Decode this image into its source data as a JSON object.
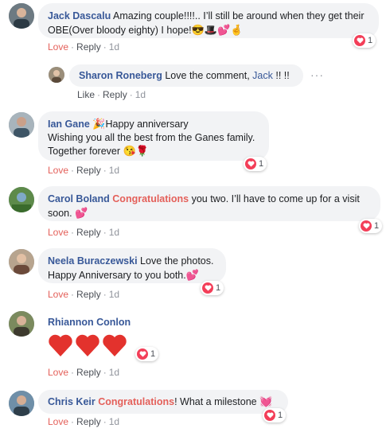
{
  "comments": [
    {
      "name": "Jack Dascalu",
      "text": "Amazing couple!!!!.. I’ll still be around when they get their OBE(Over bloody eighty) I hope!",
      "emoji": "😎🎩💕🤞",
      "reactions": "1",
      "love": "Love",
      "reply": "Reply",
      "time": "1d"
    },
    {
      "name": "Sharon Roneberg",
      "text_before": "Love the comment,",
      "mention": "Jack",
      "text_after": "!! !!",
      "more": "···",
      "like": "Like",
      "reply": "Reply",
      "time": "1d"
    },
    {
      "name": "Ian Gane",
      "emoji_start": "🎉",
      "line1": "Happy anniversary",
      "line2": "Wishing you all the best from the Ganes family.",
      "line3": "Together forever",
      "emoji_end": "😘🌹",
      "reactions": "1",
      "love": "Love",
      "reply": "Reply",
      "time": "1d"
    },
    {
      "name": "Carol Boland",
      "tag": "Congratulations",
      "text": "you two. I’ll have to come up for a visit soon.",
      "emoji": "💕",
      "reactions": "1",
      "love": "Love",
      "reply": "Reply",
      "time": "1d"
    },
    {
      "name": "Neela Buraczewski",
      "text_a": "Love the photos.",
      "text_b": "Happy Anniversary to you both.",
      "emoji": "💕",
      "reactions": "1",
      "love": "Love",
      "reply": "Reply",
      "time": "1d"
    },
    {
      "name": "Rhiannon Conlon",
      "reactions": "1",
      "love": "Love",
      "reply": "Reply",
      "time": "1d"
    },
    {
      "name": "Chris Keir",
      "tag": "Congratulations",
      "text": "! What a milestone",
      "emoji": "💓",
      "reactions": "1",
      "love": "Love",
      "reply": "Reply",
      "time": "1d"
    }
  ],
  "colors": {
    "name": "#385898",
    "love": "#e4605a",
    "bubble": "#f2f3f5",
    "heart": "#f33e58"
  }
}
